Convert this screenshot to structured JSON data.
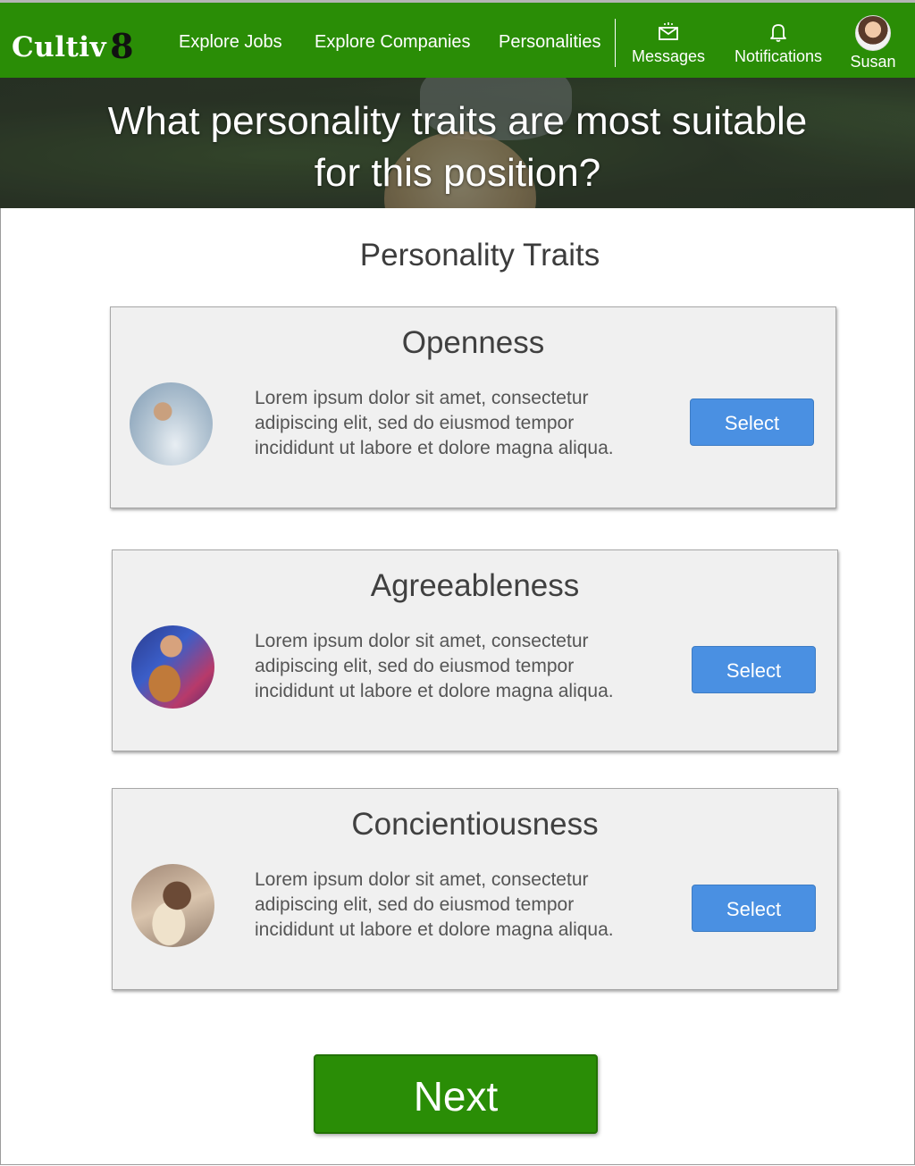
{
  "nav": {
    "logo_text": "Cultiv",
    "logo_number": "8",
    "links": [
      "Explore Jobs",
      "Explore Companies",
      "Personalities"
    ],
    "messages_label": "Messages",
    "notifications_label": "Notifications",
    "user_name": "Susan",
    "brand_color": "#2a8d06"
  },
  "hero": {
    "title_line1": "What personality traits are most suitable",
    "title_line2": "for this position?"
  },
  "section_title": "Personality Traits",
  "traits": [
    {
      "name": "Openness",
      "description_lines": [
        "Lorem ipsum dolor sit amet, consectetur",
        "adipiscing elit, sed do eiusmod tempor",
        "incididunt ut labore et dolore magna aliqua."
      ],
      "button_label": "Select"
    },
    {
      "name": "Agreeableness",
      "description_lines": [
        "Lorem ipsum dolor sit amet, consectetur",
        "adipiscing elit, sed do eiusmod tempor",
        "incididunt ut labore et dolore magna aliqua."
      ],
      "button_label": "Select"
    },
    {
      "name": "Concientiousness",
      "description_lines": [
        "Lorem ipsum dolor sit amet, consectetur",
        "adipiscing elit, sed do eiusmod tempor",
        "incididunt ut labore et dolore magna aliqua."
      ],
      "button_label": "Select"
    }
  ],
  "next_label": "Next",
  "button_color": "#4a90e2"
}
